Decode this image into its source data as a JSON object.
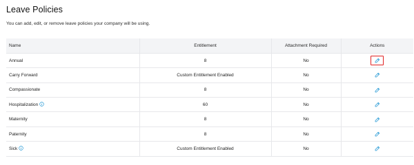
{
  "page": {
    "title": "Leave Policies",
    "subtitle": "You can add, edit, or remove leave policies your company will be using."
  },
  "table": {
    "headers": {
      "name": "Name",
      "entitlement": "Entitlement",
      "attachment": "Attachment Required",
      "actions": "Actions"
    },
    "rows": [
      {
        "name": "Annual",
        "entitlement": "8",
        "attachment": "No",
        "info": false,
        "highlighted": true
      },
      {
        "name": "Carry Forward",
        "entitlement": "Custom Entitlement Enabled",
        "attachment": "No",
        "info": false,
        "highlighted": false
      },
      {
        "name": "Compassionate",
        "entitlement": "8",
        "attachment": "No",
        "info": false,
        "highlighted": false
      },
      {
        "name": "Hospitalization",
        "entitlement": "60",
        "attachment": "No",
        "info": true,
        "highlighted": false
      },
      {
        "name": "Maternity",
        "entitlement": "8",
        "attachment": "No",
        "info": false,
        "highlighted": false
      },
      {
        "name": "Paternity",
        "entitlement": "8",
        "attachment": "No",
        "info": false,
        "highlighted": false
      },
      {
        "name": "Sick",
        "entitlement": "Custom Entitlement Enabled",
        "attachment": "No",
        "info": true,
        "highlighted": false
      }
    ]
  },
  "icons": {
    "edit": "pencil-icon",
    "info": "info-circle-icon"
  },
  "colors": {
    "accent": "#2a9bd6",
    "highlight_border": "#e02020",
    "header_bg": "#f3f4f6"
  }
}
